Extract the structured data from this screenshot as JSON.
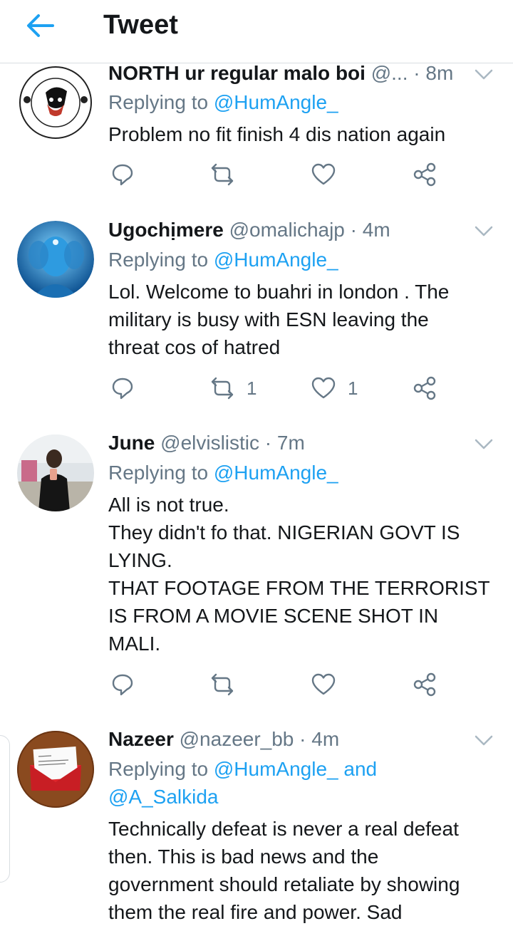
{
  "header": {
    "title": "Tweet",
    "back_icon": "arrow-left-icon"
  },
  "colors": {
    "accent": "#1da1f2",
    "muted": "#657786",
    "text": "#14171a"
  },
  "tweets": [
    {
      "name": "NORTH ur regular malo boi",
      "handle": "@...",
      "time": "8m",
      "replying_prefix": "Replying to ",
      "replying_to": "@HumAngle_",
      "replying_extra": "",
      "body": [
        "Problem no fit finish 4 dis nation again"
      ],
      "retweets": "",
      "likes": ""
    },
    {
      "name": "Ugochịmere",
      "handle": "@omalichajp",
      "time": "4m",
      "replying_prefix": "Replying to ",
      "replying_to": "@HumAngle_",
      "replying_extra": "",
      "body": [
        "Lol. Welcome to buahri in london . The",
        "military is busy with ESN leaving the",
        "threat cos of hatred"
      ],
      "retweets": "1",
      "likes": "1"
    },
    {
      "name": "June",
      "handle": "@elvislistic",
      "time": "7m",
      "replying_prefix": "Replying to ",
      "replying_to": "@HumAngle_",
      "replying_extra": "",
      "body": [
        "All is not true.",
        "They didn't fo that. NIGERIAN GOVT IS",
        "LYING.",
        "THAT FOOTAGE FROM THE TERRORIST",
        "IS FROM A MOVIE SCENE SHOT IN",
        "MALI."
      ],
      "retweets": "",
      "likes": ""
    },
    {
      "name": "Nazeer",
      "handle": "@nazeer_bb",
      "time": "4m",
      "replying_prefix": "Replying to ",
      "replying_to": "@HumAngle_ and",
      "replying_extra": "@A_Salkida",
      "body": [
        "Technically defeat is never a real defeat",
        "then. This is bad news and the",
        "government should retaliate by showing",
        "them the real fire and power. Sad"
      ],
      "retweets": "",
      "likes": ""
    }
  ],
  "separator": " · "
}
